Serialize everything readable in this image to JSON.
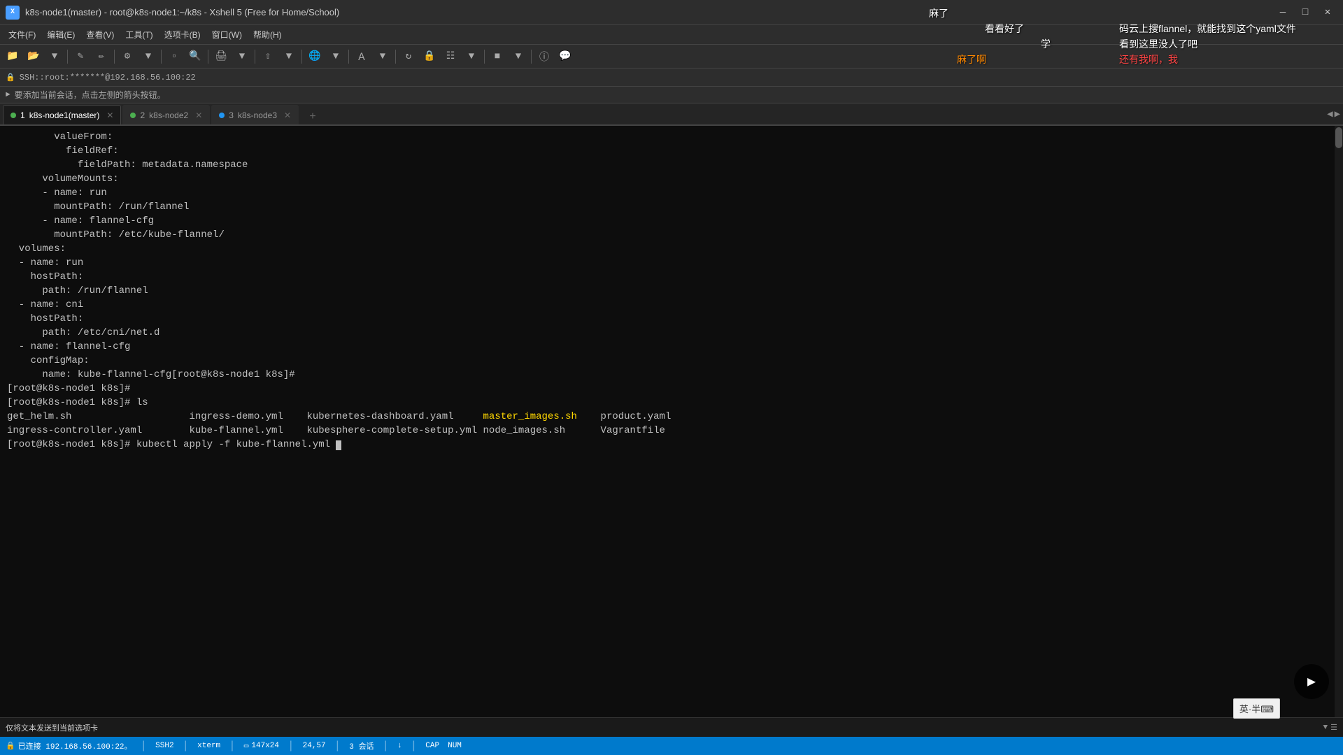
{
  "window": {
    "title": "k8s-node1(master) - root@k8s-node1:~/k8s - Xshell 5 (Free for Home/School)",
    "icon_letter": "X"
  },
  "menu": {
    "items": [
      "文件(F)",
      "编辑(E)",
      "查看(V)",
      "工具(T)",
      "选项卡(B)",
      "窗口(W)",
      "帮助(H)"
    ]
  },
  "address_bar": {
    "ssh_address": "SSH::root:*******@192.168.56.100:22"
  },
  "session_bar": {
    "hint": "要添加当前会话，点击左侧的箭头按钮。"
  },
  "tabs": [
    {
      "id": 1,
      "label": "k8s-node1(master)",
      "active": true,
      "dot_color": "green"
    },
    {
      "id": 2,
      "label": "k8s-node2",
      "active": false,
      "dot_color": "green"
    },
    {
      "id": 3,
      "label": "k8s-node3",
      "active": false,
      "dot_color": "blue"
    }
  ],
  "terminal": {
    "lines": [
      {
        "text": "        valueFrom:",
        "style": "normal"
      },
      {
        "text": "          fieldRef:",
        "style": "normal"
      },
      {
        "text": "            fieldPath: metadata.namespace",
        "style": "normal"
      },
      {
        "text": "      volumeMounts:",
        "style": "normal"
      },
      {
        "text": "      - name: run",
        "style": "normal"
      },
      {
        "text": "        mountPath: /run/flannel",
        "style": "normal"
      },
      {
        "text": "      - name: flannel-cfg",
        "style": "normal"
      },
      {
        "text": "        mountPath: /etc/kube-flannel/",
        "style": "normal"
      },
      {
        "text": "  volumes:",
        "style": "normal"
      },
      {
        "text": "  - name: run",
        "style": "normal"
      },
      {
        "text": "    hostPath:",
        "style": "normal"
      },
      {
        "text": "      path: /run/flannel",
        "style": "normal"
      },
      {
        "text": "  - name: cni",
        "style": "normal"
      },
      {
        "text": "    hostPath:",
        "style": "normal"
      },
      {
        "text": "      path: /etc/cni/net.d",
        "style": "normal"
      },
      {
        "text": "  - name: flannel-cfg",
        "style": "normal"
      },
      {
        "text": "    configMap:",
        "style": "normal"
      },
      {
        "text": "      name: kube-flannel-cfg[root@k8s-node1 k8s]#",
        "style": "normal"
      },
      {
        "text": "[root@k8s-node1 k8s]#",
        "style": "normal"
      },
      {
        "text": "[root@k8s-node1 k8s]# ls",
        "style": "normal"
      },
      {
        "text": "get_helm.sh                    ingress-demo.yml    kubernetes-dashboard.yaml     master_images.sh    product.yaml",
        "style": "ls"
      },
      {
        "text": "ingress-controller.yaml        kube-flannel.yml    kubesphere-complete-setup.yml node_images.sh      Vagrantfile",
        "style": "ls"
      },
      {
        "text": "[root@k8s-node1 k8s]# kubectl apply -f kube-flannel.yml ",
        "style": "prompt_cmd"
      }
    ],
    "ls_line1": {
      "col1": "get_helm.sh",
      "col2": "ingress-demo.yml",
      "col3": "kubernetes-dashboard.yaml",
      "col4_highlight": "master_images.sh",
      "col5": "product.yaml"
    },
    "ls_line2": {
      "col1": "ingress-controller.yaml",
      "col2": "kube-flannel.yml",
      "col3": "kubesphere-complete-setup.yml",
      "col4": "node_images.sh",
      "col5": "Vagrantfile"
    },
    "last_cmd": "[root@k8s-node1 k8s]# kubectl apply -f kube-flannel.yml "
  },
  "input_bar": {
    "text": "仅将文本发送到当前选项卡"
  },
  "status_bar": {
    "connection": "已连接 192.168.56.100:22。",
    "ssh_label": "SSH2",
    "terminal_type": "xterm",
    "dimensions": "147x24",
    "cursor_pos": "24,57",
    "sessions": "3 会话",
    "cap_label": "CAP",
    "num_label": "NUM"
  },
  "ime_indicator": {
    "text": "英·半⌨"
  },
  "chat_overlay": {
    "messages": [
      {
        "text": "码云上搜flannel，就能找到这个yaml文件",
        "style": "white"
      },
      {
        "text": "看到这里没人了吧",
        "style": "white"
      },
      {
        "text": "还有我啊，我",
        "style": "red"
      }
    ]
  },
  "top_chat": {
    "messages": [
      {
        "text": "麻了",
        "style": "white"
      },
      {
        "text": "看看好了",
        "style": "white"
      },
      {
        "text": "学",
        "style": "white"
      },
      {
        "text": "麻了啊",
        "style": "orange"
      }
    ]
  }
}
